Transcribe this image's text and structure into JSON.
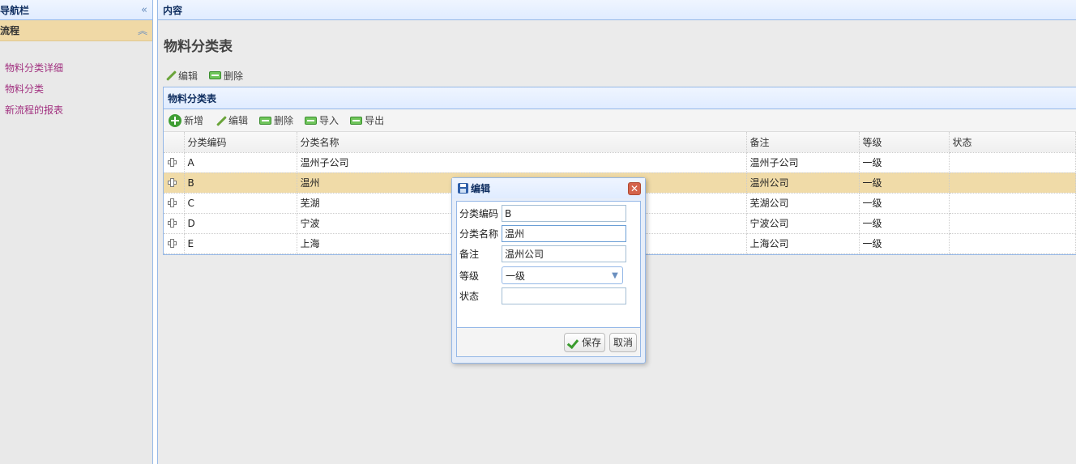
{
  "sidebar": {
    "title": "导航栏",
    "section_title": "流程",
    "items": [
      {
        "label": "物料分类详细"
      },
      {
        "label": "物料分类"
      },
      {
        "label": "新流程的报表"
      }
    ]
  },
  "content": {
    "header_title": "内容",
    "page_title": "物料分类表",
    "top_toolbar": {
      "edit_label": "编辑",
      "delete_label": "删除"
    }
  },
  "grid": {
    "title": "物料分类表",
    "toolbar": {
      "add_label": "新增",
      "edit_label": "编辑",
      "delete_label": "删除",
      "import_label": "导入",
      "export_label": "导出"
    },
    "columns": [
      "分类编码",
      "分类名称",
      "备注",
      "等级",
      "状态"
    ],
    "rows": [
      {
        "code": "A",
        "name": "温州子公司",
        "remark": "温州子公司",
        "level": "一级",
        "status": ""
      },
      {
        "code": "B",
        "name": "温州",
        "remark": "温州公司",
        "level": "一级",
        "status": ""
      },
      {
        "code": "C",
        "name": "芜湖",
        "remark": "芜湖公司",
        "level": "一级",
        "status": ""
      },
      {
        "code": "D",
        "name": "宁波",
        "remark": "宁波公司",
        "level": "一级",
        "status": ""
      },
      {
        "code": "E",
        "name": "上海",
        "remark": "上海公司",
        "level": "一级",
        "status": ""
      }
    ],
    "selected_row": "B"
  },
  "dialog": {
    "title": "编辑",
    "fields": {
      "code_label": "分类编码",
      "code_value": "B",
      "name_label": "分类名称",
      "name_value": "温州",
      "remark_label": "备注",
      "remark_value": "温州公司",
      "level_label": "等级",
      "level_value": "一级",
      "status_label": "状态",
      "status_value": ""
    },
    "save_label": "保存",
    "cancel_label": "取消"
  },
  "colors": {
    "accent": "#95b8e7",
    "selected_row": "#f0dba8",
    "nav_link": "#a1307f"
  }
}
